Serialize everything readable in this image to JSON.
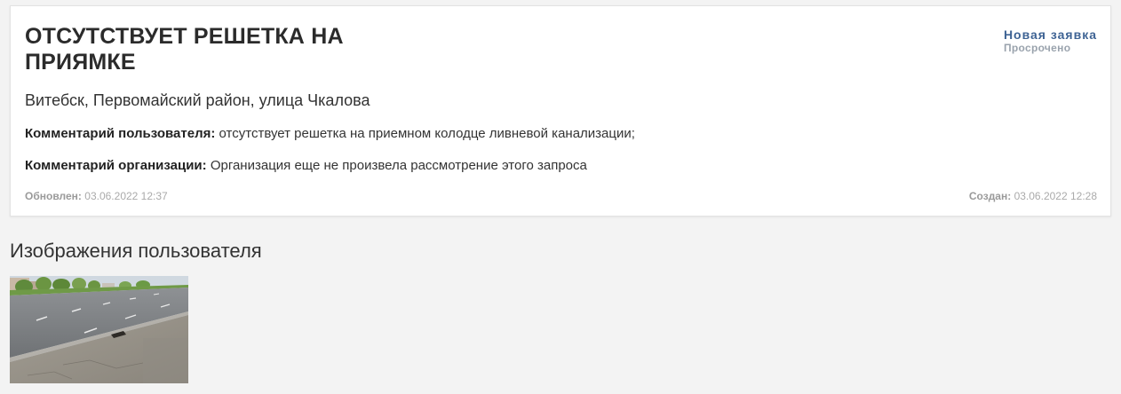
{
  "request": {
    "title": "Отсутствует решетка на приямке",
    "status": "Новая заявка",
    "status_sub": "Просрочено",
    "address": "Витебск, Первомайский район, улица Чкалова",
    "user_comment_label": "Комментарий пользователя:",
    "user_comment": "отсутствует решетка на приемном колодце ливневой канализации;",
    "org_comment_label": "Комментарий организации:",
    "org_comment": "Организация еще не произвела рассмотрение этого запроса",
    "updated_label": "Обновлен:",
    "updated_value": "03.06.2022 12:37",
    "created_label": "Создан:",
    "created_value": "03.06.2022 12:28"
  },
  "images_section": {
    "title": "Изображения пользователя"
  },
  "colors": {
    "status": "#3e6394",
    "status_sub": "#9aa3ad",
    "background": "#f3f3f3"
  }
}
